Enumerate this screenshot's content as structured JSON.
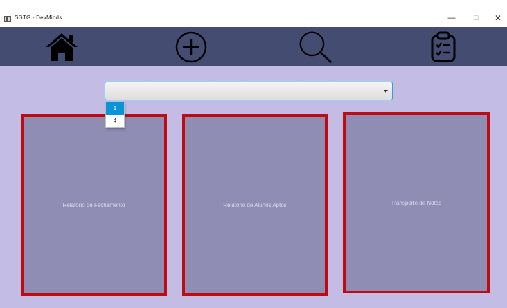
{
  "window": {
    "title": "SGTG - DevMinds",
    "minimize_label": "—",
    "maximize_label": "☐",
    "close_label": "✕"
  },
  "nav": {
    "items": [
      {
        "name": "home",
        "icon": "home-icon"
      },
      {
        "name": "add",
        "icon": "plus-circle-icon"
      },
      {
        "name": "search",
        "icon": "search-icon"
      },
      {
        "name": "tasks",
        "icon": "clipboard-check-icon"
      }
    ]
  },
  "combo": {
    "value": "",
    "options": [
      "1",
      "4"
    ],
    "highlighted_option": "1"
  },
  "cards": [
    {
      "label": "Relatório de Fechamento"
    },
    {
      "label": "Relatório de Alunos Aptos"
    },
    {
      "label": "Transporte de Notas"
    }
  ],
  "colors": {
    "navbar": "#444c72",
    "background": "#c3bde6",
    "card_fill": "#908db5",
    "card_border": "#c00a12",
    "selection": "#0a93d6"
  }
}
